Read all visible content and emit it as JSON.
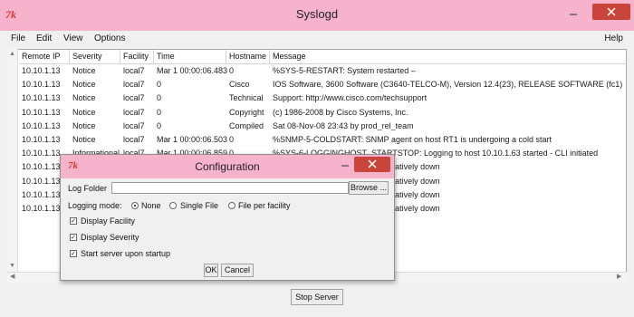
{
  "app": {
    "title": "Syslogd",
    "icon_glyph": "7k",
    "accent_color": "#f7b2cc",
    "close_color": "#c9443b"
  },
  "menu": [
    "File",
    "Edit",
    "View",
    "Options"
  ],
  "help_menu": "Help",
  "table": {
    "columns": [
      "Remote IP",
      "Severity",
      "Facility",
      "Time",
      "Hostname",
      "Message"
    ],
    "rows": [
      [
        "10.10.1.13",
        "Notice",
        "local7",
        "Mar 1 00:00:06.483",
        "0",
        "%SYS-5-RESTART: System restarted –"
      ],
      [
        "10.10.1.13",
        "Notice",
        "local7",
        "0",
        "Cisco",
        "IOS Software, 3600 Software (C3640-TELCO-M), Version 12.4(23), RELEASE SOFTWARE (fc1)"
      ],
      [
        "10.10.1.13",
        "Notice",
        "local7",
        "0",
        "Technical",
        "Support: http://www.cisco.com/techsupport"
      ],
      [
        "10.10.1.13",
        "Notice",
        "local7",
        "0",
        "Copyright",
        "(c) 1986-2008 by Cisco Systems, Inc."
      ],
      [
        "10.10.1.13",
        "Notice",
        "local7",
        "0",
        "Compiled",
        "Sat 08-Nov-08 23:43 by prod_rel_team"
      ],
      [
        "10.10.1.13",
        "Notice",
        "local7",
        "Mar 1 00:00:06.503",
        "0",
        "%SNMP-5-COLDSTART: SNMP agent on host RT1 is undergoing a cold start"
      ],
      [
        "10.10.1.13",
        "Informational",
        "local7",
        "Mar 1 00:00:06.859",
        "0",
        "%SYS-6-LOGGINGHOST_STARTSTOP: Logging to host 10.10.1.63 started - CLI initiated"
      ],
      [
        "10.10.1.13",
        "",
        "",
        "",
        "",
        "rial1/0, changed state to administratively down"
      ],
      [
        "10.10.1.13",
        "",
        "",
        "",
        "",
        "rial1/1, changed state to administratively down"
      ],
      [
        "10.10.1.13",
        "",
        "",
        "",
        "",
        "rial1/2, changed state to administratively down"
      ],
      [
        "10.10.1.13",
        "",
        "",
        "",
        "",
        "rial1/3, changed state to administratively down"
      ]
    ]
  },
  "stop_button": "Stop Server",
  "dialog": {
    "title": "Configuration",
    "log_folder_label": "Log Folder",
    "log_folder_value": "",
    "browse_label": "Browse ...",
    "logging_mode_label": "Logging mode:",
    "modes": [
      {
        "label": "None",
        "selected": true
      },
      {
        "label": "Single File",
        "selected": false
      },
      {
        "label": "File per facility",
        "selected": false
      }
    ],
    "checkboxes": [
      {
        "label": "Display Facility",
        "checked": true
      },
      {
        "label": "Display Severity",
        "checked": true
      },
      {
        "label": "Start server upon startup",
        "checked": true
      }
    ],
    "ok_label": "OK",
    "cancel_label": "Cancel"
  }
}
